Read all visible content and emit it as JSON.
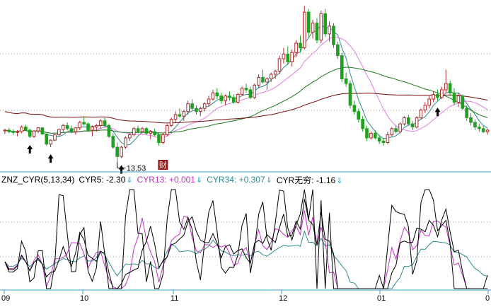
{
  "chart_data": [
    {
      "type": "candlestick",
      "panel": "price",
      "low_label": "13.53",
      "event_marker": "财",
      "ma_series": [
        {
          "color": "#2e8b8b"
        },
        {
          "color": "#e27ee2"
        },
        {
          "color": "#1a7a1a"
        },
        {
          "color": "#7a0a0a"
        }
      ],
      "candles": [
        [
          15.55,
          15.7,
          15.35,
          15.6
        ],
        [
          15.6,
          15.75,
          15.4,
          15.5
        ],
        [
          15.5,
          15.65,
          15.3,
          15.45
        ],
        [
          15.45,
          15.6,
          15.2,
          15.5
        ],
        [
          15.5,
          15.9,
          15.4,
          15.8
        ],
        [
          15.8,
          15.95,
          15.55,
          15.6
        ],
        [
          15.6,
          15.7,
          15.1,
          15.2
        ],
        [
          15.2,
          15.6,
          15.1,
          15.55
        ],
        [
          15.55,
          15.8,
          15.4,
          15.75
        ],
        [
          15.75,
          15.8,
          15.3,
          15.35
        ],
        [
          15.35,
          15.4,
          14.6,
          14.7
        ],
        [
          14.7,
          15.0,
          14.5,
          14.95
        ],
        [
          14.95,
          15.35,
          14.9,
          15.3
        ],
        [
          15.3,
          15.7,
          15.2,
          15.65
        ],
        [
          15.65,
          16.0,
          15.5,
          15.9
        ],
        [
          15.9,
          16.1,
          15.6,
          15.7
        ],
        [
          15.7,
          15.9,
          15.4,
          15.5
        ],
        [
          15.5,
          15.8,
          15.3,
          15.75
        ],
        [
          15.75,
          16.2,
          15.6,
          16.1
        ],
        [
          16.1,
          16.5,
          15.9,
          16.0
        ],
        [
          16.0,
          16.1,
          15.5,
          15.6
        ],
        [
          15.6,
          15.9,
          15.2,
          15.8
        ],
        [
          15.8,
          16.0,
          15.5,
          15.9
        ],
        [
          15.9,
          16.3,
          15.7,
          16.2
        ],
        [
          16.2,
          16.4,
          15.8,
          15.9
        ],
        [
          15.9,
          16.0,
          15.1,
          15.2
        ],
        [
          15.2,
          15.4,
          14.4,
          14.5
        ],
        [
          14.5,
          14.8,
          13.53,
          13.9
        ],
        [
          13.9,
          14.6,
          13.8,
          14.5
        ],
        [
          14.5,
          15.2,
          14.4,
          15.1
        ],
        [
          15.1,
          15.4,
          14.9,
          15.3
        ],
        [
          15.3,
          15.8,
          15.2,
          15.7
        ],
        [
          15.7,
          15.9,
          15.4,
          15.5
        ],
        [
          15.5,
          15.8,
          15.4,
          15.7
        ],
        [
          15.7,
          15.8,
          15.3,
          15.4
        ],
        [
          15.4,
          15.6,
          15.0,
          15.5
        ],
        [
          15.5,
          15.7,
          15.2,
          15.3
        ],
        [
          15.3,
          15.4,
          14.6,
          14.8
        ],
        [
          14.8,
          15.4,
          14.7,
          15.3
        ],
        [
          15.3,
          16.0,
          15.2,
          15.9
        ],
        [
          15.9,
          16.4,
          15.8,
          16.3
        ],
        [
          16.3,
          16.8,
          16.1,
          16.6
        ],
        [
          16.6,
          17.0,
          16.4,
          16.5
        ],
        [
          16.5,
          16.9,
          16.2,
          16.8
        ],
        [
          16.8,
          17.5,
          16.6,
          17.3
        ],
        [
          17.3,
          17.6,
          16.9,
          17.0
        ],
        [
          17.0,
          17.2,
          16.6,
          16.8
        ],
        [
          16.8,
          17.1,
          16.5,
          17.0
        ],
        [
          17.0,
          17.4,
          16.8,
          17.3
        ],
        [
          17.3,
          17.8,
          17.1,
          17.6
        ],
        [
          17.6,
          18.2,
          17.5,
          18.0
        ],
        [
          18.0,
          18.3,
          17.6,
          17.8
        ],
        [
          17.8,
          18.0,
          17.3,
          17.5
        ],
        [
          17.5,
          17.9,
          17.2,
          17.8
        ],
        [
          17.8,
          18.1,
          17.5,
          17.7
        ],
        [
          17.7,
          17.9,
          17.3,
          17.4
        ],
        [
          17.4,
          18.0,
          17.3,
          17.9
        ],
        [
          17.9,
          18.4,
          17.8,
          18.3
        ],
        [
          18.3,
          18.6,
          18.0,
          18.2
        ],
        [
          18.2,
          18.4,
          17.6,
          17.7
        ],
        [
          17.7,
          18.6,
          17.6,
          18.5
        ],
        [
          18.5,
          19.2,
          18.3,
          19.0
        ],
        [
          19.0,
          19.5,
          18.6,
          18.7
        ],
        [
          18.7,
          19.0,
          18.2,
          18.9
        ],
        [
          18.9,
          19.3,
          18.7,
          19.2
        ],
        [
          19.2,
          19.5,
          18.9,
          19.4
        ],
        [
          19.4,
          20.4,
          19.2,
          20.2
        ],
        [
          20.2,
          20.9,
          19.9,
          20.5
        ],
        [
          20.5,
          21.0,
          19.8,
          20.0
        ],
        [
          20.0,
          20.8,
          19.7,
          20.6
        ],
        [
          20.6,
          21.4,
          20.3,
          21.2
        ],
        [
          21.2,
          21.7,
          20.6,
          20.9
        ],
        [
          20.9,
          23.6,
          20.8,
          23.2
        ],
        [
          23.2,
          23.4,
          21.6,
          21.9
        ],
        [
          21.9,
          22.7,
          21.5,
          22.5
        ],
        [
          22.5,
          22.8,
          21.2,
          21.4
        ],
        [
          21.4,
          23.3,
          21.2,
          23.1
        ],
        [
          23.1,
          23.4,
          21.6,
          21.8
        ],
        [
          21.8,
          22.6,
          21.3,
          22.3
        ],
        [
          22.3,
          22.5,
          20.9,
          21.1
        ],
        [
          21.1,
          21.3,
          20.2,
          20.4
        ],
        [
          20.4,
          20.6,
          18.7,
          18.9
        ],
        [
          18.9,
          19.3,
          18.4,
          18.6
        ],
        [
          18.6,
          18.8,
          17.0,
          17.2
        ],
        [
          17.2,
          17.5,
          16.6,
          16.8
        ],
        [
          16.8,
          17.0,
          16.1,
          16.3
        ],
        [
          16.3,
          16.5,
          15.5,
          15.7
        ],
        [
          15.7,
          15.9,
          14.9,
          15.1
        ],
        [
          15.1,
          15.5,
          15.0,
          15.4
        ],
        [
          15.4,
          15.6,
          15.0,
          15.1
        ],
        [
          15.1,
          15.3,
          14.7,
          14.9
        ],
        [
          14.9,
          15.1,
          14.6,
          14.8
        ],
        [
          14.8,
          15.5,
          14.7,
          15.3
        ],
        [
          15.3,
          15.8,
          15.2,
          15.7
        ],
        [
          15.7,
          15.9,
          15.4,
          15.5
        ],
        [
          15.5,
          16.1,
          15.4,
          16.0
        ],
        [
          16.0,
          16.5,
          15.9,
          16.4
        ],
        [
          16.4,
          16.6,
          15.9,
          16.0
        ],
        [
          16.0,
          16.2,
          15.6,
          15.8
        ],
        [
          15.8,
          16.5,
          15.7,
          16.4
        ],
        [
          16.4,
          17.0,
          16.3,
          16.9
        ],
        [
          16.9,
          17.4,
          16.7,
          17.2
        ],
        [
          17.2,
          17.8,
          17.0,
          17.6
        ],
        [
          17.6,
          18.1,
          17.4,
          17.9
        ],
        [
          17.9,
          18.2,
          17.5,
          17.7
        ],
        [
          17.7,
          18.4,
          17.6,
          18.2
        ],
        [
          18.2,
          19.5,
          18.0,
          18.6
        ],
        [
          18.6,
          18.8,
          17.8,
          18.0
        ],
        [
          18.0,
          18.3,
          17.2,
          17.4
        ],
        [
          17.4,
          18.0,
          17.1,
          17.8
        ],
        [
          17.8,
          17.9,
          16.9,
          17.0
        ],
        [
          17.0,
          17.2,
          16.2,
          16.4
        ],
        [
          16.4,
          16.7,
          15.9,
          16.1
        ],
        [
          16.1,
          16.3,
          15.6,
          15.8
        ],
        [
          15.8,
          16.0,
          15.5,
          15.7
        ],
        [
          15.7,
          15.9,
          15.4,
          15.5
        ],
        [
          15.5,
          15.7,
          15.3,
          15.6
        ]
      ]
    },
    {
      "type": "line",
      "panel": "indicator",
      "legend": {
        "name": "ZNZ_CYR(5,13,34)",
        "items": [
          {
            "label": "CYR5: -2.30",
            "arrow": "⇓",
            "color": "#000000"
          },
          {
            "label": "CYR13: +0.001",
            "arrow": "⇓",
            "color": "#c032c0"
          },
          {
            "label": "CYR34: +0.307",
            "arrow": "⇓",
            "color": "#2e8b8b"
          },
          {
            "label": "CYR无穷: -1.16",
            "arrow": "⇓",
            "color": "#000000"
          }
        ]
      },
      "x_tick_labels": [
        "09",
        "10",
        "11",
        "12",
        "01",
        "0"
      ],
      "zero": 0
    }
  ],
  "colors": {
    "up": "#b02a2a",
    "down": "#20a020",
    "arrow_up": "#000000",
    "grid": "#9a9a9a",
    "axis": "#3aa0c8",
    "event_bg": "#8b1a1a",
    "event_fg": "#ffffff"
  },
  "icons": {
    "buy_marker": "up-arrow-icon",
    "event_marker": "finance-event-icon"
  }
}
